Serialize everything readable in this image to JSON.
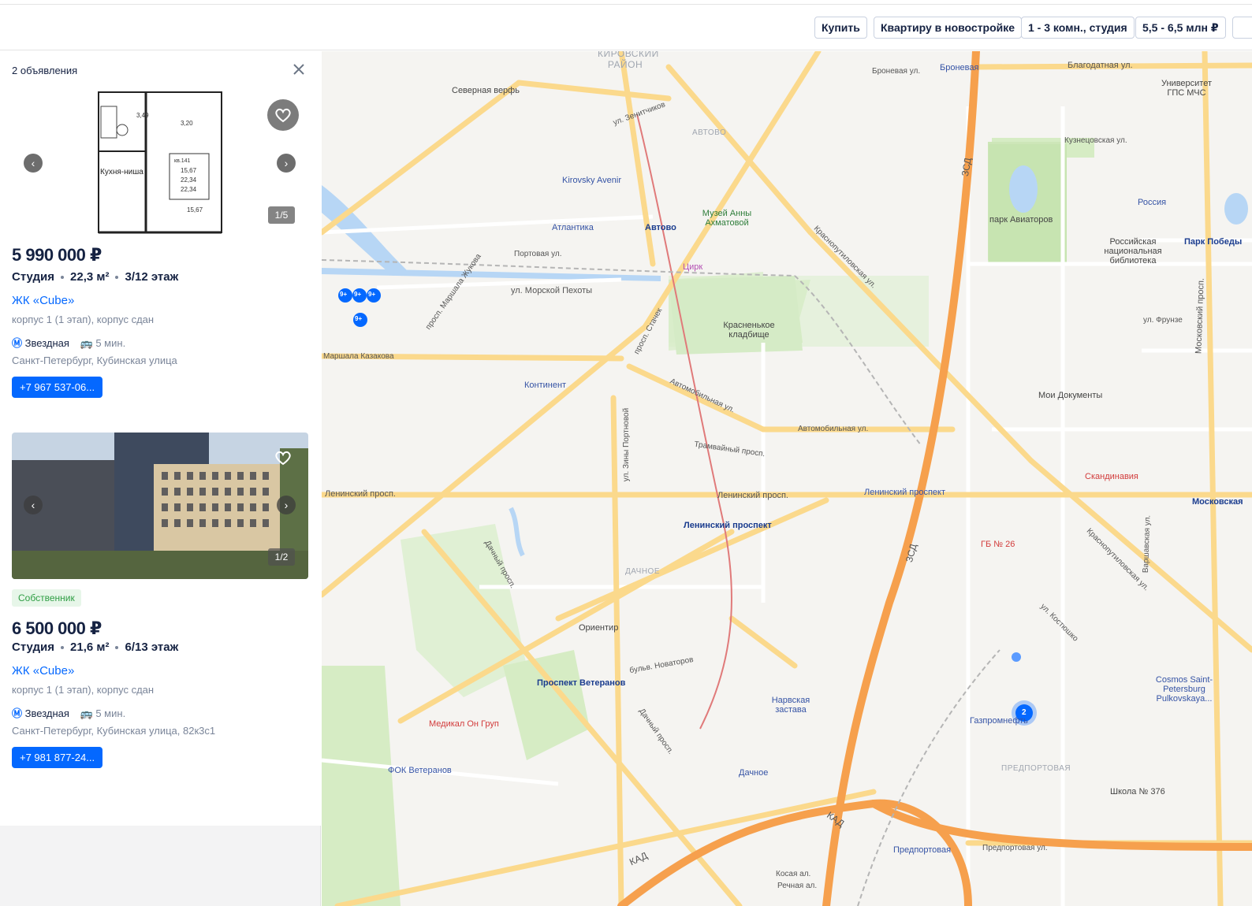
{
  "filters": {
    "deal": "Купить",
    "object": "Квартиру в новостройке",
    "rooms": "1 - 3 комн., студия",
    "price": "5,5 - 6,5 млн ₽"
  },
  "sidebar": {
    "count_label": "2 объявления",
    "listings": [
      {
        "photo_counter": "1/5",
        "price": "5 990 000 ₽",
        "type": "Студия",
        "area": "22,3 м²",
        "floor": "3/12 этаж",
        "complex": "ЖК «Cube»",
        "building": "корпус 1 (1 этап), корпус сдан",
        "metro": "Звездная",
        "metro_time": "5 мин.",
        "address": "Санкт-Петербург, Кубинская улица",
        "phone": "+7 967 537-06..."
      },
      {
        "photo_counter": "1/2",
        "badge": "Собственник",
        "price": "6 500 000 ₽",
        "type": "Студия",
        "area": "21,6 м²",
        "floor": "6/13 этаж",
        "complex": "ЖК «Cube»",
        "building": "корпус 1 (1 этап), корпус сдан",
        "metro": "Звездная",
        "metro_time": "5 мин.",
        "address": "Санкт-Петербург, Кубинская улица, 82к3с1",
        "phone": "+7 981 877-24..."
      }
    ]
  },
  "map": {
    "pois": {
      "severnaya_verf": "Северная верфь",
      "kirovsky_avenir": "Kirovsky Avenir",
      "atlantika": "Атлантика",
      "avtovo": "Автово",
      "muzey": "Музей Анны Ахматовой",
      "tsirk": "Цирк",
      "krasnenkoe": "Красненькое кладбище",
      "kontinent": "Континент",
      "leninsky_metro": "Ленинский проспект",
      "leninsky_rail": "Ленинский проспект",
      "orientir": "Ориентир",
      "veteranov": "Проспект Ветеранов",
      "medikal": "Медикал Он Груп",
      "fok": "ФОК Ветеранов",
      "narvskaya": "Нарвская застава",
      "dachnoe": "Дачное",
      "gazpromneft": "Газпромнефть",
      "shkola": "Школа № 376",
      "predportovaya": "Предпортовая",
      "gb26": "ГБ № 26",
      "skandinaviya": "Скандинавия",
      "moi_dokumenty": "Мои Документы",
      "park_aviatorov": "парк Авиаторов",
      "rossiya": "Россия",
      "rnb": "Российская национальная библиотека",
      "universitet": "Университет ГПС МЧС",
      "park_pobedy": "Парк Победы",
      "moskovskaya": "Московская",
      "cosmos": "Cosmos Saint-Petersburg Pulkovskaya...",
      "bronevaya": "Броневая"
    },
    "districts": {
      "kirovsky": "КИРОВСКИЙ РАЙОН",
      "avtovo": "АВТОВО",
      "dachnoe": "ДАЧНОЕ",
      "predportovaya": "ПРЕДПОРТОВАЯ"
    },
    "streets": {
      "zenitchikov": "ул. Зенитчиков",
      "marshala_zhukova": "просп. Маршала Жукова",
      "stachek": "просп. Стачек",
      "leninsky1": "Ленинский просп.",
      "leninsky2": "Ленинский просп.",
      "avtomobilnaya": "Автомобильная ул.",
      "avtomobilnaya2": "Автомобильная ул.",
      "tramvainy": "Трамвайный просп.",
      "krasnoputilovskaya": "Краснопутиловская ул.",
      "krasnoputilovskaya2": "Краснопутиловская ул.",
      "morskoy_pekhoty": "ул. Морской Пехоты",
      "portovaya": "Портовая ул.",
      "dachny": "Дачный просп.",
      "dachny2": "Дачный просп.",
      "novatorov": "бульв. Новаторов",
      "zsd": "ЗСД",
      "kad": "КАД",
      "blagodatnaya": "Благодатная ул.",
      "kuznetsovskaya": "Кузнецовская ул.",
      "moskovsky": "Московский просп.",
      "frunze": "ул. Фрунзе",
      "predportovaya_st": "Предпортовая ул.",
      "kostyushko": "ул. Костюшко",
      "varshavskaya": "Варшавская ул.",
      "zziny_portnovoy": "ул. Зины Портновой",
      "marshala_kazakova": "Маршала Казакова",
      "bronevaya_ul": "Броневая ул.",
      "kosaya": "Косая ал.",
      "rechnaya": "Речная ал."
    },
    "cluster_count": "2",
    "small_cluster": "9+"
  },
  "colors": {
    "accent": "#0468ff",
    "text": "#152242",
    "muted": "#7a8599",
    "road": "#fbd98c",
    "highway": "#f6a04d",
    "park": "#d6ecc4",
    "water": "#b7d6f5"
  }
}
